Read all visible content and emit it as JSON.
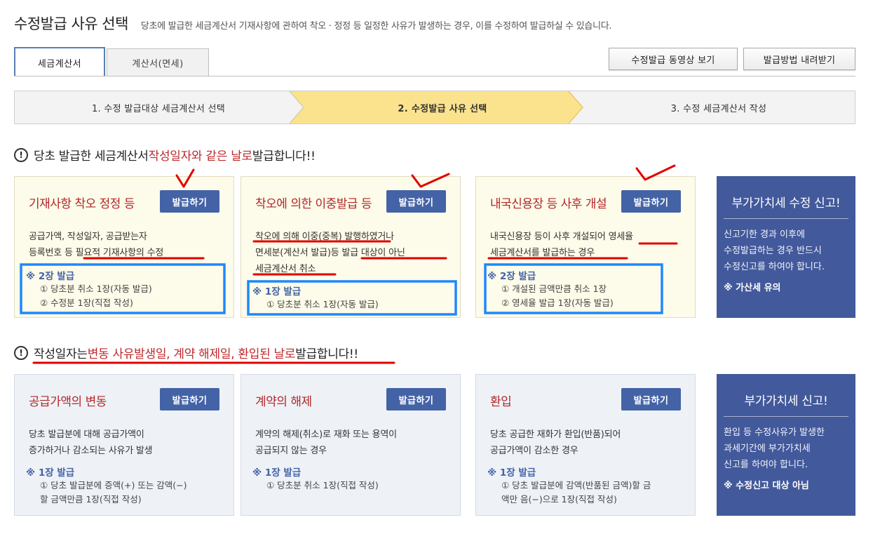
{
  "header": {
    "title": "수정발급 사유 선택",
    "description": "당초에 발급한 세금계산서 기재사항에 관하여 착오 · 정정 등 일정한 사유가 발생하는 경우, 이를 수정하여 발급하실 수 있습니다."
  },
  "tabs": [
    {
      "label": "세금계산서",
      "active": true
    },
    {
      "label": "계산서(면세)",
      "active": false
    }
  ],
  "top_buttons": {
    "video": "수정발급 동영상 보기",
    "download": "발급방법 내려받기"
  },
  "steps": [
    "1. 수정 발급대상 세금계산서 선택",
    "2. 수정발급 사유 선택",
    "3. 수정 세금계산서 작성"
  ],
  "section1": {
    "p1": "당초 발급한 세금계산서 ",
    "highlight": "작성일자와 같은 날로",
    "p2": " 발급합니다!!"
  },
  "section2": {
    "p1": "작성일자는 ",
    "highlight": "변동 사유발생일, 계약 해제일, 환입된 날로",
    "p2": " 발급합니다!!"
  },
  "issue_label": "발급하기",
  "cards_row1": [
    {
      "title": "기재사항 착오 정정 등",
      "desc": [
        "공급가액, 작성일자, 공급받는자",
        "등록번호 등 필요적 기재사항의 수정"
      ],
      "note_head": "※ 2장 발급",
      "notes": [
        "① 당초분 취소 1장(자동 발급)",
        "② 수정분 1장(직접 작성)"
      ]
    },
    {
      "title": "착오에 의한 이중발급 등",
      "desc": [
        "착오에 의해 이중(중복) 발행하였거나",
        "면세분(계산서 발급)등 발급 대상이 아닌",
        "세금계산서 취소"
      ],
      "note_head": "※ 1장 발급",
      "notes": [
        "① 당초분 취소 1장(자동 발급)"
      ]
    },
    {
      "title": "내국신용장 등 사후 개설",
      "desc": [
        "내국신용장 등이 사후 개설되어 영세율",
        "세금계산서를 발급하는 경우"
      ],
      "note_head": "※ 2장 발급",
      "notes": [
        "① 개설된 금액만큼 취소 1장",
        "② 영세율 발급 1장(자동 발급)"
      ]
    }
  ],
  "cards_row2": [
    {
      "title": "공급가액의 변동",
      "desc": [
        "당초 발급분에 대해 공급가액이",
        "증가하거나 감소되는 사유가 발생"
      ],
      "note_head": "※ 1장 발급",
      "notes": [
        "① 당초 발급분에 증액(+) 또는 감액(−)",
        "할 금액만큼 1장(직접 작성)"
      ]
    },
    {
      "title": "계약의 해제",
      "desc": [
        "계약의 해제(취소)로 재화 또는 용역이",
        "공급되지 않는 경우"
      ],
      "note_head": "※ 1장 발급",
      "notes": [
        "① 당초분 취소 1장(직접 작성)"
      ]
    },
    {
      "title": "환입",
      "desc": [
        "당초 공급한 재화가 환입(반품)되어",
        "공급가액이 감소한 경우"
      ],
      "note_head": "※ 1장 발급",
      "notes": [
        "① 당초 발급분에 감액(반품된 금액)할 금",
        "액만 음(−)으로 1장(직접 작성)"
      ]
    }
  ],
  "side1": {
    "title": "부가가치세 수정 신고!",
    "text": [
      "신고기한 경과 이후에",
      "수정발급하는 경우 반드시",
      "수정신고를 하여야 합니다."
    ],
    "warn": "※ 가산세 유의"
  },
  "side2": {
    "title": "부가가치세 신고!",
    "text": [
      "환입 등 수정사유가 발생한",
      "과세기간에 부가가치세",
      "신고를 하여야 합니다."
    ],
    "warn": "※ 수정신고 대상 아님"
  },
  "colors": {
    "accent_blue": "#4463a6",
    "side_blue": "#42599b",
    "title_red": "#c0282b",
    "active_step": "#fbe38e",
    "markup_red": "#e00000",
    "markup_blue": "#1e88ff"
  }
}
